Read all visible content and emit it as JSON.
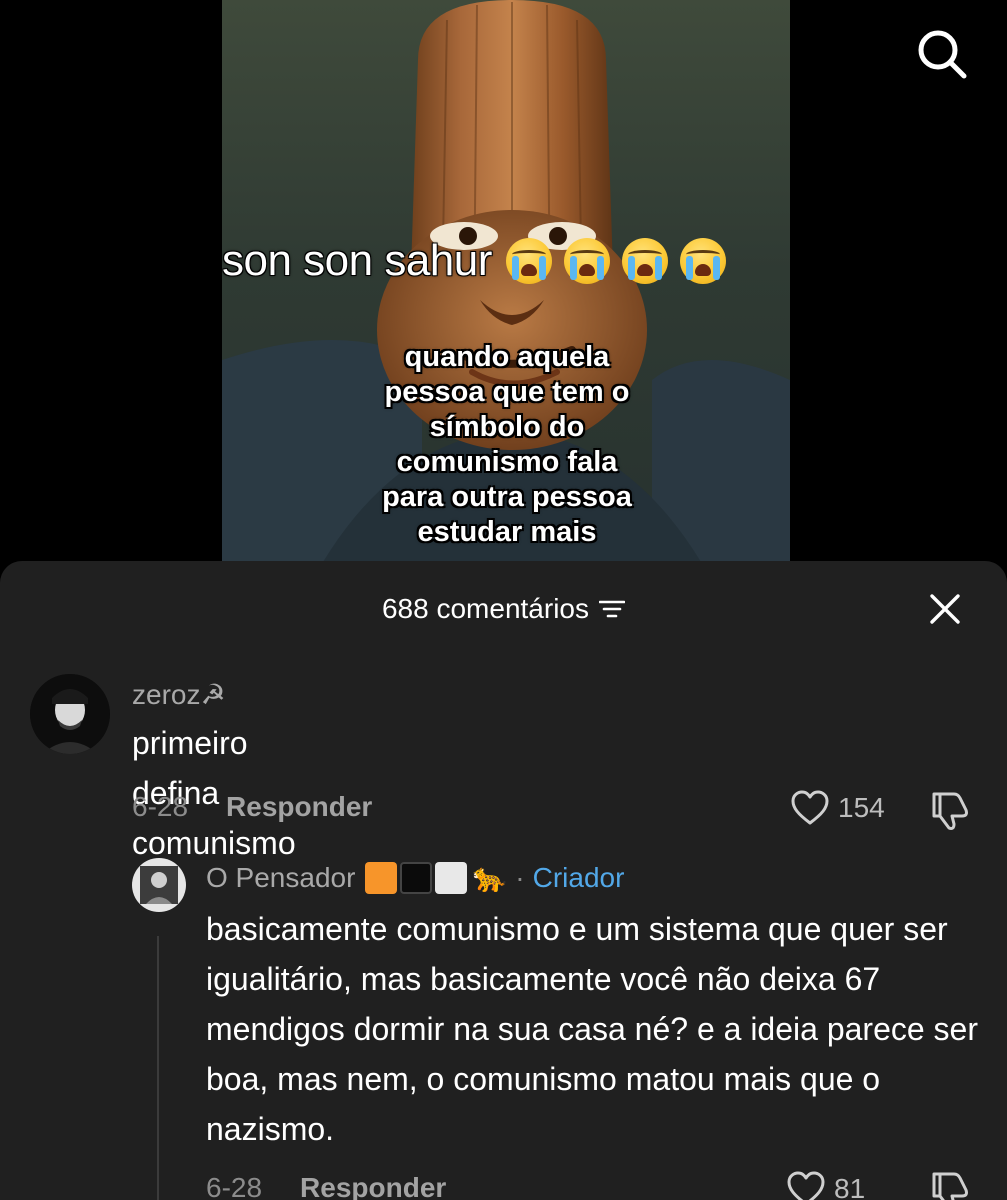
{
  "video": {
    "meme_title": "son son sahur",
    "meme_emojis": [
      "loudly-crying-face",
      "loudly-crying-face",
      "loudly-crying-face",
      "loudly-crying-face"
    ],
    "meme_caption": "quando aquela pessoa que tem o símbolo do comunismo fala para outra pessoa estudar mais"
  },
  "top_bar": {
    "search_icon": "search-icon"
  },
  "comments_sheet": {
    "count_label": "688 comentários",
    "sort_icon": "sort-lines-icon",
    "close_icon": "close-icon",
    "comments": [
      {
        "username": "zeroz☭",
        "text": "primeiro defina comunismo",
        "date": "6-28",
        "reply_label": "Responder",
        "likes": "154"
      }
    ],
    "replies": [
      {
        "username": "O Pensador",
        "badges": [
          "#f7952a",
          "#0b0b0b",
          "#e8e8e8"
        ],
        "animal_emoji": "🐆",
        "creator_sep": "·",
        "creator_label": "Criador",
        "text": "basicamente comunismo e um sistema que quer ser igualitário, mas basicamente você não deixa 67 mendigos dormir na sua casa né? e a ideia parece ser boa, mas nem, o comunismo matou mais que o nazismo.",
        "date": "6-28",
        "reply_label": "Responder",
        "likes": "81"
      }
    ]
  },
  "colors": {
    "sheet_bg": "#202020",
    "username": "#a9a9a9",
    "creator": "#52a8e8",
    "meta": "#8c8c8c"
  }
}
